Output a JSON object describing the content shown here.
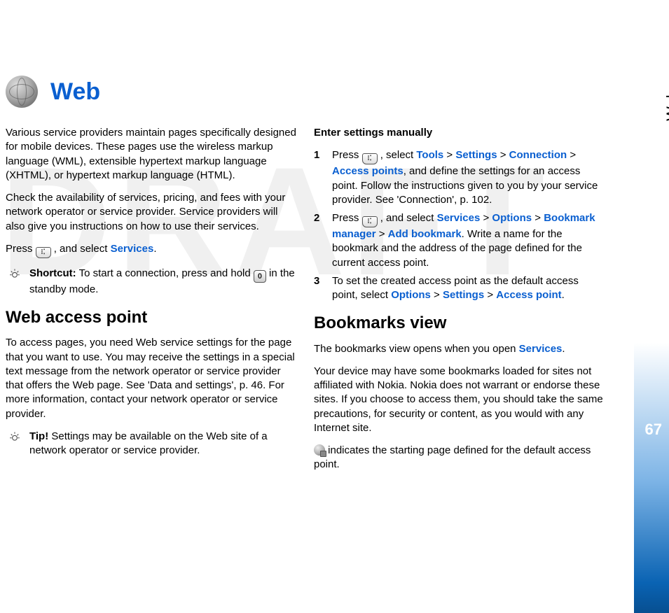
{
  "side": {
    "label": "Web",
    "page_number": "67"
  },
  "watermark": "DRAFT",
  "title": "Web",
  "col1": {
    "p1": "Various service providers maintain pages specifically designed for mobile devices. These pages use the wireless markup language (WML), extensible hypertext markup language (XHTML), or hypertext markup language (HTML).",
    "p2": "Check the availability of services, pricing, and fees with your network operator or service provider. Service providers will also give you instructions on how to use their services.",
    "p3_a": "Press ",
    "p3_b": " , and select ",
    "p3_services": "Services",
    "p3_c": ".",
    "shortcut_label": "Shortcut:",
    "shortcut_a": " To start a connection, press and hold ",
    "shortcut_key": "0",
    "shortcut_b": " in the standby mode.",
    "h2": "Web access point",
    "p4": "To access pages, you need Web service settings for the page that you want to use. You may receive the settings in a special text message from the network operator or service provider that offers the Web page. See 'Data and settings', p. 46. For more information, contact your network operator or service provider.",
    "tip_label": "Tip!",
    "tip_text": " Settings may be available on the Web site of a network operator or service provider."
  },
  "col2": {
    "subhead": "Enter settings manually",
    "s1_a": "Press ",
    "s1_b": " , select ",
    "s1_tools": "Tools",
    "gt": " > ",
    "s1_settings": "Settings",
    "s1_connection": "Connection",
    "s1_access_points": "Access points",
    "s1_c": ", and define the settings for an access point. Follow the instructions given to you by your service provider. See 'Connection', p. 102.",
    "s2_a": "Press ",
    "s2_b": " , and select ",
    "s2_services": "Services",
    "s2_options": "Options",
    "s2_bkmgr": "Bookmark manager",
    "s2_addbk": "Add bookmark",
    "s2_c": ". Write a name for the bookmark and the address of the page defined for the current access point.",
    "s3_a": "To set the created access point as the default access point, select ",
    "s3_options": "Options",
    "s3_settings": "Settings",
    "s3_ap": "Access point",
    "s3_b": ".",
    "h2": "Bookmarks view",
    "p1_a": "The bookmarks view opens when you open ",
    "p1_services": "Services",
    "p1_b": ".",
    "p2": "Your device may have some bookmarks loaded for sites not affiliated with Nokia. Nokia does not warrant or endorse these sites. If you choose to access them, you should take the same precautions, for security or content, as you would with any Internet site.",
    "p3": " indicates the starting page defined for the default access point."
  },
  "steps": {
    "n1": "1",
    "n2": "2",
    "n3": "3"
  },
  "key_menu": "⁝⁚"
}
